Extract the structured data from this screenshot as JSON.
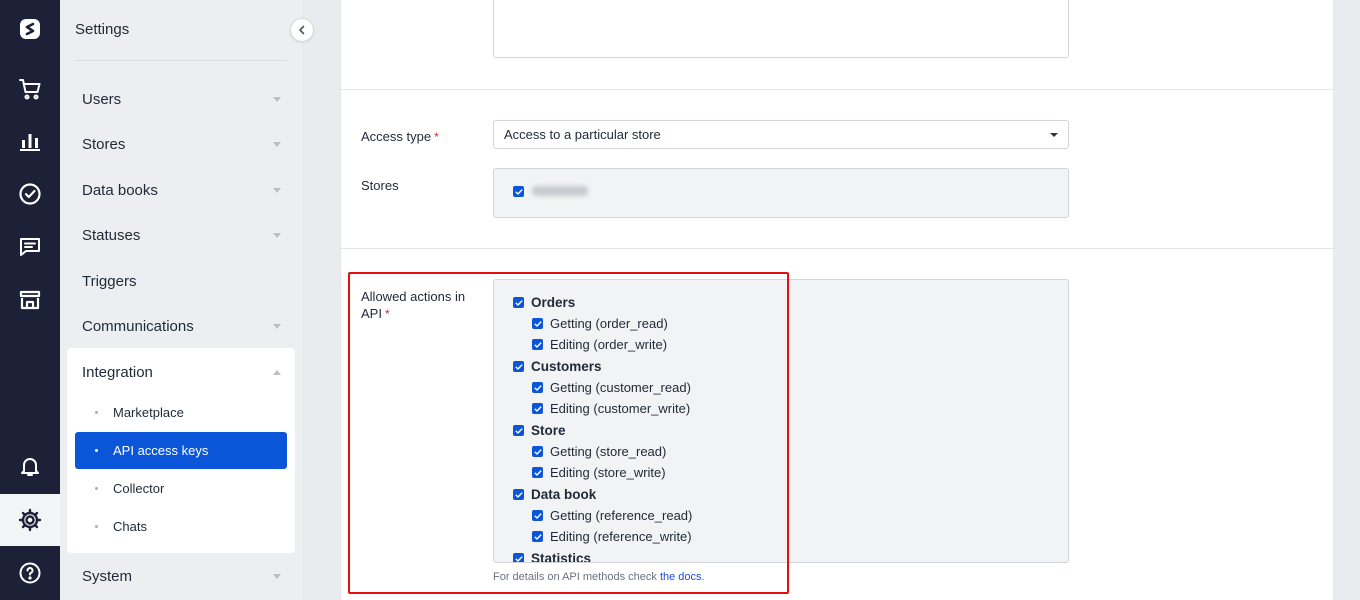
{
  "sidebar": {
    "title": "Settings",
    "items": [
      {
        "label": "Users",
        "expandable": true
      },
      {
        "label": "Stores",
        "expandable": true
      },
      {
        "label": "Data books",
        "expandable": true
      },
      {
        "label": "Statuses",
        "expandable": true
      },
      {
        "label": "Triggers",
        "expandable": false
      },
      {
        "label": "Communications",
        "expandable": true
      },
      {
        "label": "Integration",
        "expandable": true,
        "expanded": true
      },
      {
        "label": "System",
        "expandable": true
      }
    ],
    "integration_sub": [
      {
        "label": "Marketplace",
        "active": false
      },
      {
        "label": "API access keys",
        "active": true
      },
      {
        "label": "Collector",
        "active": false
      },
      {
        "label": "Chats",
        "active": false
      }
    ]
  },
  "rail": {
    "icons": [
      "logo-icon",
      "cart-icon",
      "analytics-icon",
      "tasks-icon",
      "chat-icon",
      "store-icon",
      "bell-icon",
      "gear-icon",
      "help-icon"
    ],
    "active": "gear-icon"
  },
  "form": {
    "access_type_label": "Access type",
    "access_type_value": "Access to a particular store",
    "stores_label": "Stores",
    "allowed_actions_label": "Allowed actions in API",
    "required_mark": "*",
    "groups": [
      {
        "label": "Orders",
        "checked": true,
        "items": [
          {
            "label": "Getting (order_read)",
            "checked": true
          },
          {
            "label": "Editing (order_write)",
            "checked": true
          }
        ]
      },
      {
        "label": "Customers",
        "checked": true,
        "items": [
          {
            "label": "Getting (customer_read)",
            "checked": true
          },
          {
            "label": "Editing (customer_write)",
            "checked": true
          }
        ]
      },
      {
        "label": "Store",
        "checked": true,
        "items": [
          {
            "label": "Getting (store_read)",
            "checked": true
          },
          {
            "label": "Editing (store_write)",
            "checked": true
          }
        ]
      },
      {
        "label": "Data book",
        "checked": true,
        "items": [
          {
            "label": "Getting (reference_read)",
            "checked": true
          },
          {
            "label": "Editing (reference_write)",
            "checked": true
          }
        ]
      },
      {
        "label": "Statistics",
        "checked": true,
        "items": []
      }
    ],
    "help_text": "For details on API methods check",
    "help_link": "the docs",
    "help_suffix": "."
  },
  "colors": {
    "rail_bg": "#1c2137",
    "accent": "#0b56d8",
    "highlight": "#e40e0e",
    "required": "#e0281b"
  }
}
